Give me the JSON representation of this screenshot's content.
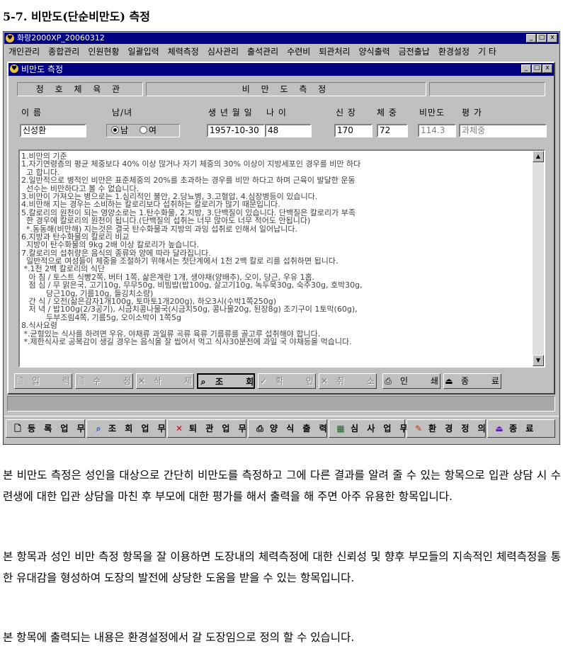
{
  "doc_title": "5-7. 비만도(단순비만도) 측정",
  "window": {
    "title": "화랑2000XP_20060312",
    "controls": [
      "_",
      "□",
      "x"
    ]
  },
  "menu": [
    "개인관리",
    "종합관리",
    "인원현황",
    "일괄입력",
    "체력측정",
    "심사관리",
    "출석관리",
    "수련비",
    "퇴관처리",
    "양식출력",
    "금전출납",
    "환경설정",
    "기 타"
  ],
  "child": {
    "title": "비만도 측정",
    "header": {
      "gym_name": "청 호 체 육 관",
      "form_title": "비 만 도   측 정",
      "extra": ""
    },
    "labels": {
      "name": "이 름",
      "gender": "남/녀",
      "birth": "생 년 월 일",
      "age": "나 이",
      "height": "신 장",
      "weight": "체 중",
      "bmi": "비만도",
      "eval": "평 가"
    },
    "fields": {
      "name": "신성환",
      "male": "남",
      "female": "여",
      "gender_selected": "male",
      "birth": "1957-10-30",
      "age": "48",
      "height": "170",
      "weight": "72",
      "bmi": "114.3",
      "eval": "과체중"
    },
    "memo_lines": [
      "1.비만의 기준",
      "1.자기연령층의 평균 체중보다 40% 이상 많거나 자기 체중의 30% 이상이 지방세포인 경우를 비만 하다",
      "  고 합니다.",
      "2.일반적으로 병적인 비만은 표준체중의 20%를 초과하는 경우를 비만 하다고 하며 근육이 발달한 운동",
      "  선수는 비만하다고 볼 수 없습니다.",
      "3.비만이 가져오는 병으로는 1.심리적인 불안, 2.당뇨병, 3.고혈압, 4.심장병등이 있습니다.",
      "4.비만해 지는 경우는 소비하는 칼로리보다 섭취하는 칼로리가 많기 때문입니다.",
      "5.칼로리의 원천이 되는 영양소로는 1.탄수화물, 2.지방, 3.단백질이 있습니다. 단백질은 칼로리가 부족",
      "  한 경우에 칼로리의 원천이 됩니다.(단백질의 섭취는 너무 많아도 너무 적어도 안됩니다)",
      "  *.동동해(비만해) 지는것은 결국 탄수화물과 지방의 과잉 섭취로 인해서 일어납니다.",
      "6.지방과 탄수화물의 칼로리 비교",
      "  지방이 탄수화물의 9kg 2배 이상 칼로리가 높습니다.",
      "7.칼로리의 섭취량은 음식의 종류와 양에 따라 달라집니다.",
      "  일반적으로 여성들이 체중을 조절하기 위해서는 첫단계에서 1천 2백 칼로 리를 섭취하면 됩니다.",
      " *.1천 2백 칼로리의 식단",
      "   아 침 / 토스트 식빵2쪽, 버터 1쪽, 삶은계란 1개, 생야채(양배추), 오이, 당근, 우유 1홉.",
      "   점 심 / 무 맑은국, 고기10g, 무무50g, 비빔밥(밥100g, 살고기10g, 녹두묵30g, 숙주30g, 호박30g,",
      "          당근10g, 기름10g, 들깅치소량)",
      "   간 식 / 오전(삶은감자1개100g, 토마토1개200g), 하오3시(수박1쪽250g)",
      "   저 녁 / 밥100g(2/3공기), 시금치콩나물국(시금치50g, 콩나물20g, 된장8g) 조기구이 1토막(60g),",
      "          두부조림4쪽, 기름5g, 오이소박이 1쪽5g",
      "8.식사요령",
      " *.균형있는 식사를 하려면 우유, 야채류 과일류 곡류 육류 기름류를 골고루 섭취해야 합니다.",
      " *.제한식사로 공복감이 생길 경우는 음식을 잘 씹어서 먹고 식사30분전에 과일 국 야채등을 먹습니다."
    ],
    "actions": [
      {
        "label": "입 력",
        "icon": "🗋",
        "state": "disabled"
      },
      {
        "label": "수 정",
        "icon": "🗋",
        "state": "disabled"
      },
      {
        "label": "삭 제",
        "icon": "✕",
        "state": "disabled"
      },
      {
        "label": "조 회",
        "icon": "⌕",
        "state": "selected"
      },
      {
        "label": "확 인",
        "icon": "✓",
        "state": "disabled"
      },
      {
        "label": "취 소",
        "icon": "✕",
        "state": "disabled"
      },
      {
        "label": "인 쇄",
        "icon": "⎙",
        "state": "normal"
      },
      {
        "label": "종 료",
        "icon": "⏏",
        "state": "normal"
      }
    ]
  },
  "toolbar": [
    {
      "label": "등 록 업 무",
      "icon": "🗋",
      "color": "#000000"
    },
    {
      "label": "조 회 업 무",
      "icon": "⌕",
      "color": "#2060c0"
    },
    {
      "label": "퇴 관 업 무",
      "icon": "✕",
      "color": "#d00000"
    },
    {
      "label": "양 식 출 력",
      "icon": "⎙",
      "color": "#000000"
    },
    {
      "label": "심 사 업 무",
      "icon": "▦",
      "color": "#206020"
    },
    {
      "label": "환 경 정 의",
      "icon": "✎",
      "color": "#c04000"
    },
    {
      "label": "종 료",
      "icon": "⏏",
      "color": "#6020a0"
    }
  ],
  "paragraphs": [
    "본 비만도 측정은 성인을 대상으로 간단히 비만도를 측정하고 그에 다른 결과를 알려 줄 수 있는 항목으로 입관 상담 시 수련생에 대한 입관 상담을 마친 후 부모에 대한 평가를 해서 출력을 해 주면 아주 유용한 항목입니다.",
    "본 항목과 성인 비만 측정 항목을 잘 이용하면 도장내의 체력측정에 대한 신뢰성 및 향후 부모들의 지속적인 체력측정을 통한 유대감을 형성하여 도장의 발전에 상당한 도움을 받을 수 있는 항목입니다.",
    "본 항목에 출력되는 내용은 환경설정에서 갈 도장임으로 정의 할 수 있습니다."
  ]
}
